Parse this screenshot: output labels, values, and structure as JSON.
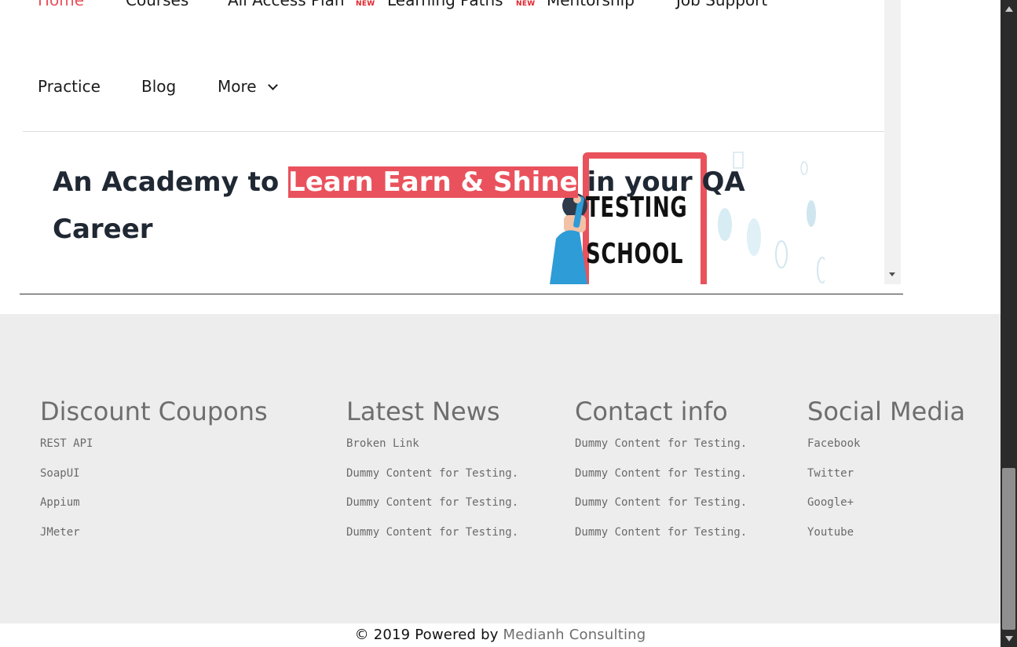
{
  "nav": {
    "row1": [
      {
        "label": "Home",
        "active": true
      },
      {
        "label": "Courses"
      },
      {
        "label": "All Access Plan",
        "badge": "NEW"
      },
      {
        "label": "Learning Paths",
        "badge": "NEW"
      },
      {
        "label": "Mentorship"
      },
      {
        "label": "Job Support"
      }
    ],
    "row2": [
      {
        "label": "Practice"
      },
      {
        "label": "Blog"
      },
      {
        "label": "More"
      }
    ]
  },
  "hero": {
    "prefix": "An Academy to ",
    "highlight": "Learn Earn & Shine",
    "suffix": "  in your QA Career",
    "image_text_line1": "TESTING",
    "image_text_line2": "SCHOOL",
    "highlight_color": "#e9525c"
  },
  "footer": {
    "columns": [
      {
        "title": "Discount Coupons",
        "links": [
          "REST API",
          "SoapUI",
          "Appium",
          "JMeter"
        ]
      },
      {
        "title": "Latest News",
        "links": [
          "Broken Link",
          "Dummy Content for Testing.",
          "Dummy Content for Testing.",
          "Dummy Content for Testing."
        ]
      },
      {
        "title": "Contact info",
        "links": [
          "Dummy Content for Testing.",
          "Dummy Content for Testing.",
          "Dummy Content for Testing.",
          "Dummy Content for Testing."
        ]
      },
      {
        "title": "Social Media",
        "links": [
          "Facebook",
          "Twitter",
          "Google+",
          "Youtube"
        ]
      }
    ]
  },
  "copyright": {
    "text": "© 2019 Powered by ",
    "brand": "Medianh Consulting"
  }
}
